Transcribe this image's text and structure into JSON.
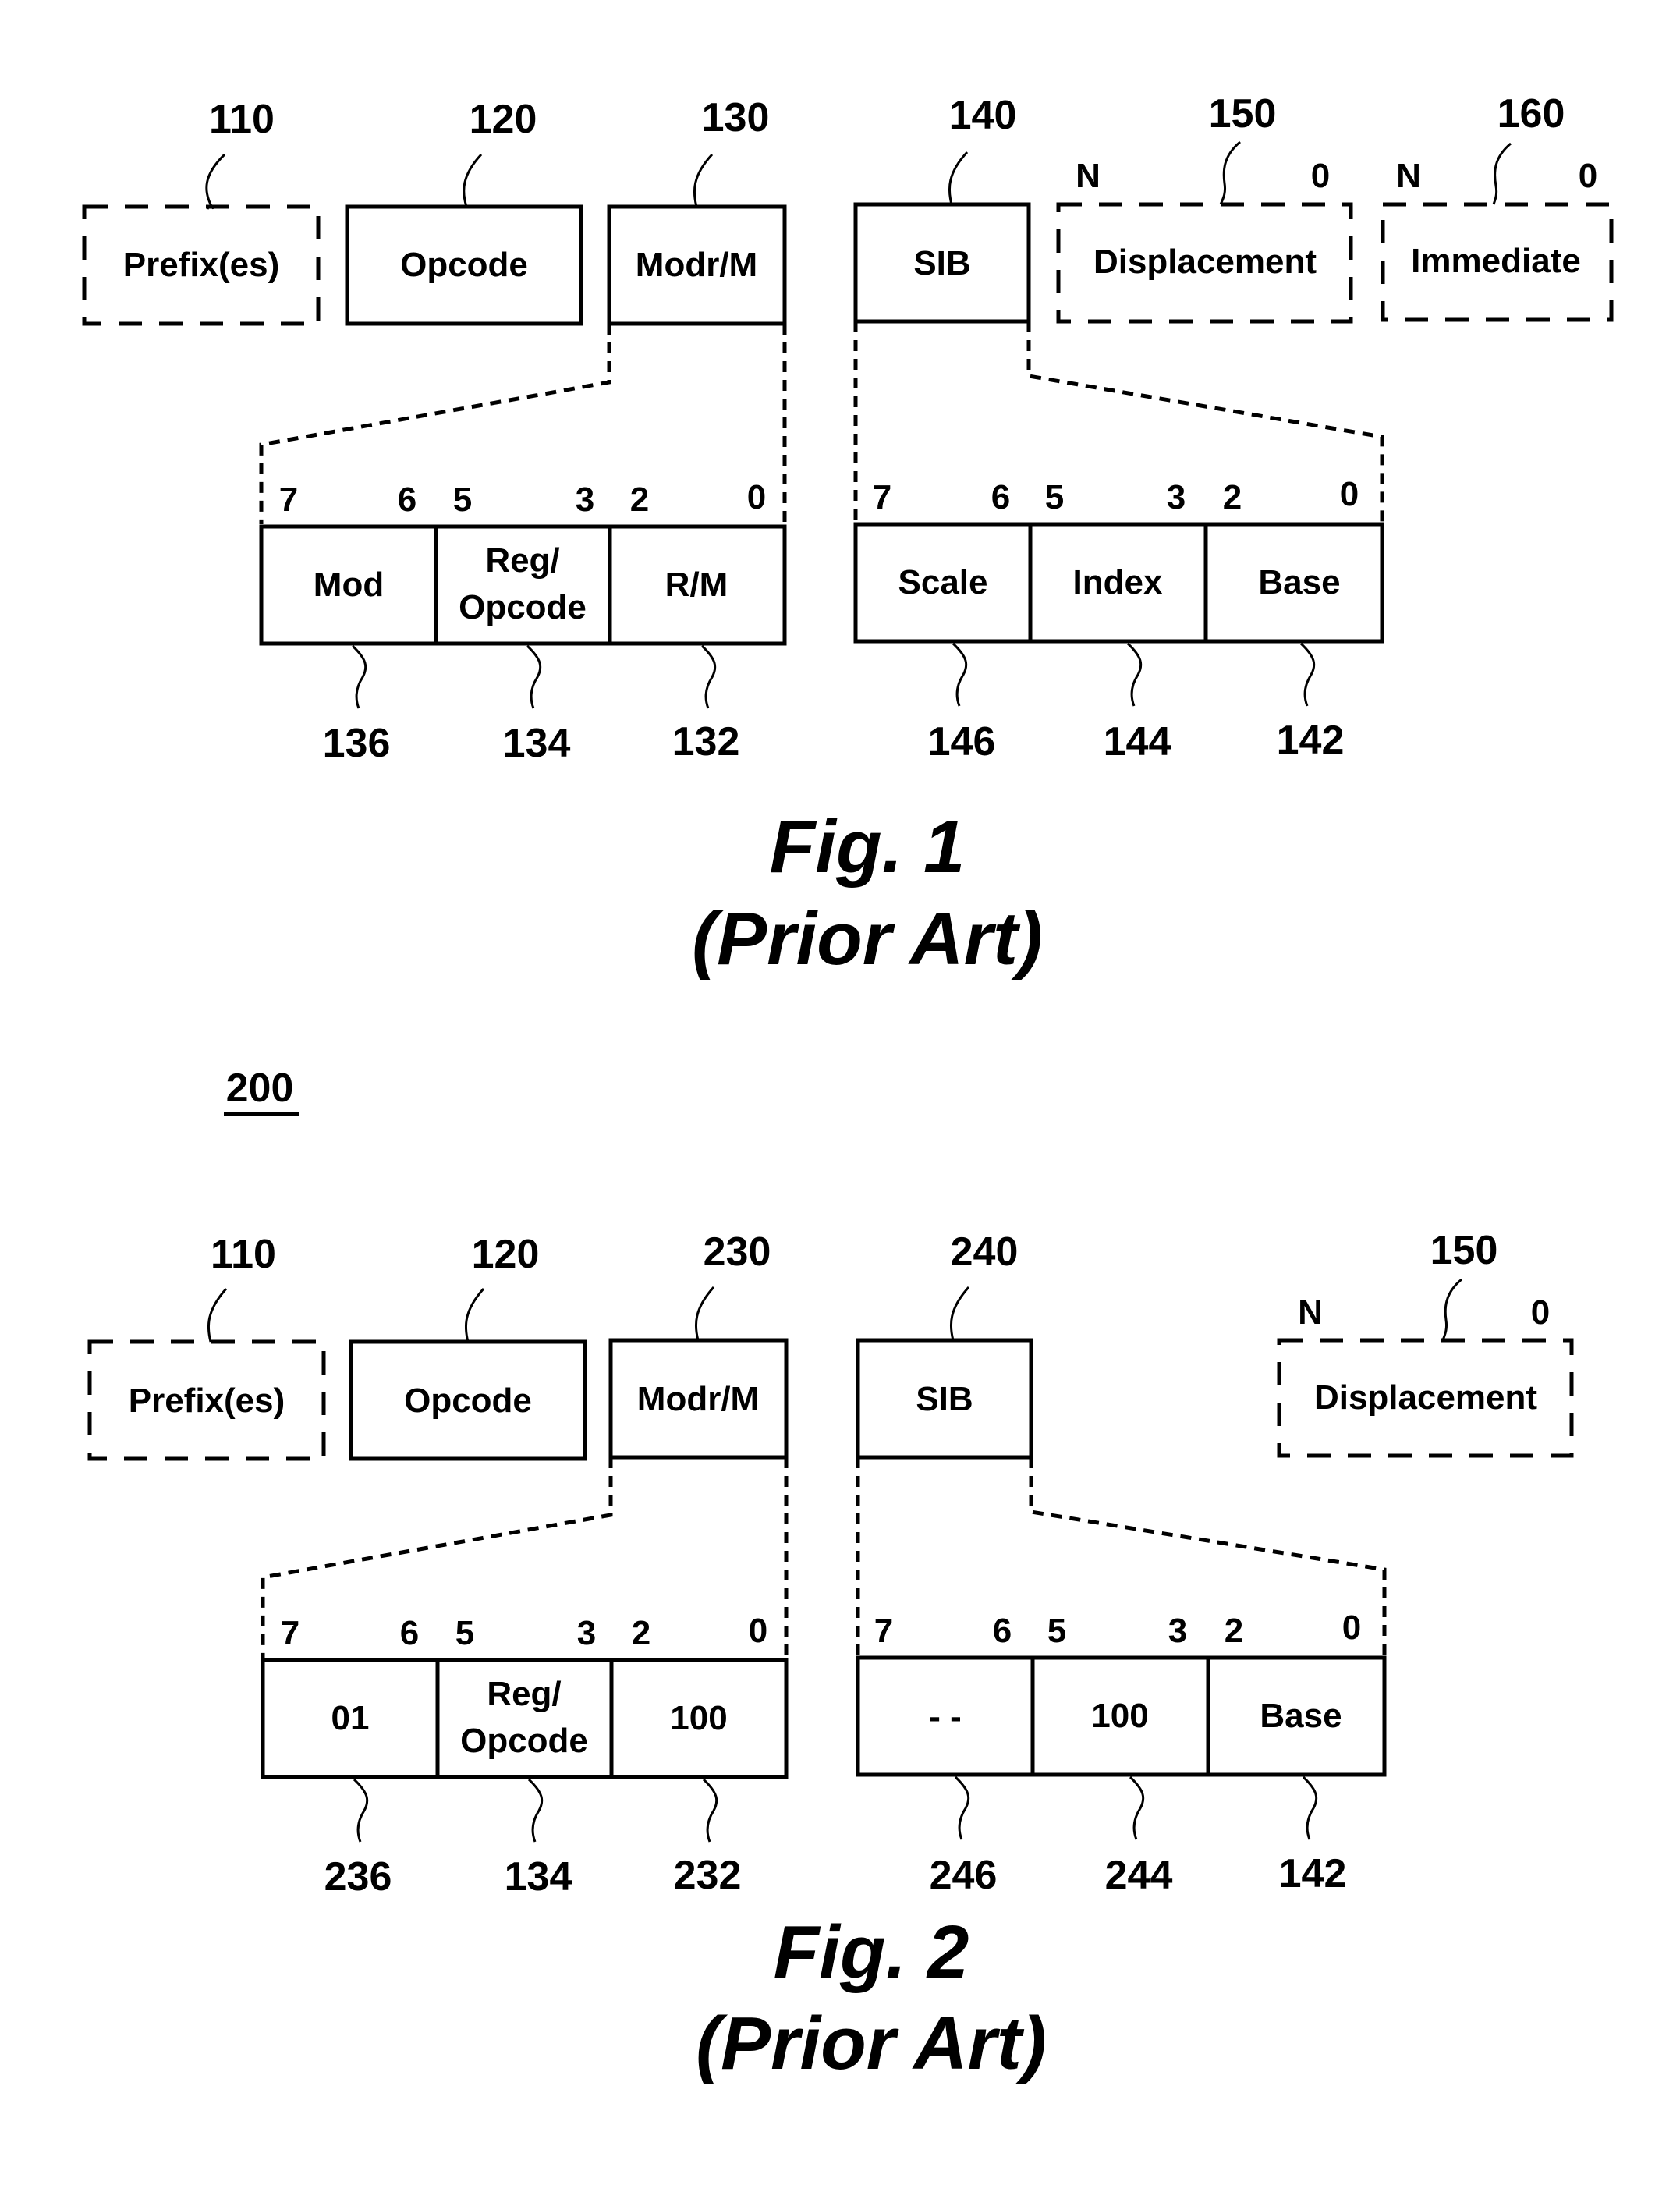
{
  "fig1": {
    "caption": "Fig. 1",
    "subcaption": "(Prior Art)",
    "fields": [
      {
        "ref": "110",
        "label": "Prefix(es)",
        "style": "dashed"
      },
      {
        "ref": "120",
        "label": "Opcode",
        "style": "solid"
      },
      {
        "ref": "130",
        "label": "Modr/M",
        "style": "solid"
      },
      {
        "ref": "140",
        "label": "SIB",
        "style": "solid"
      },
      {
        "ref": "150",
        "label": "Displacement",
        "style": "dashed",
        "range_hi": "N",
        "range_lo": "0"
      },
      {
        "ref": "160",
        "label": "Immediate",
        "style": "dashed",
        "range_hi": "N",
        "range_lo": "0"
      }
    ],
    "modrm": {
      "bits": [
        "7",
        "6",
        "5",
        "3",
        "2",
        "0"
      ],
      "cells": [
        {
          "label": "Mod",
          "ref": "136"
        },
        {
          "label1": "Reg/",
          "label2": "Opcode",
          "ref": "134"
        },
        {
          "label": "R/M",
          "ref": "132"
        }
      ]
    },
    "sib": {
      "bits": [
        "7",
        "6",
        "5",
        "3",
        "2",
        "0"
      ],
      "cells": [
        {
          "label": "Scale",
          "ref": "146"
        },
        {
          "label": "Index",
          "ref": "144"
        },
        {
          "label": "Base",
          "ref": "142"
        }
      ]
    }
  },
  "fig2": {
    "number": "200",
    "caption": "Fig. 2",
    "subcaption": "(Prior Art)",
    "fields": [
      {
        "ref": "110",
        "label": "Prefix(es)",
        "style": "dashed"
      },
      {
        "ref": "120",
        "label": "Opcode",
        "style": "solid"
      },
      {
        "ref": "230",
        "label": "Modr/M",
        "style": "solid"
      },
      {
        "ref": "240",
        "label": "SIB",
        "style": "solid"
      },
      {
        "ref": "150",
        "label": "Displacement",
        "style": "dashed",
        "range_hi": "N",
        "range_lo": "0"
      }
    ],
    "modrm": {
      "bits": [
        "7",
        "6",
        "5",
        "3",
        "2",
        "0"
      ],
      "cells": [
        {
          "label": "01",
          "ref": "236"
        },
        {
          "label1": "Reg/",
          "label2": "Opcode",
          "ref": "134"
        },
        {
          "label": "100",
          "ref": "232"
        }
      ]
    },
    "sib": {
      "bits": [
        "7",
        "6",
        "5",
        "3",
        "2",
        "0"
      ],
      "cells": [
        {
          "label": "- -",
          "ref": "246"
        },
        {
          "label": "100",
          "ref": "244"
        },
        {
          "label": "Base",
          "ref": "142"
        }
      ]
    }
  }
}
